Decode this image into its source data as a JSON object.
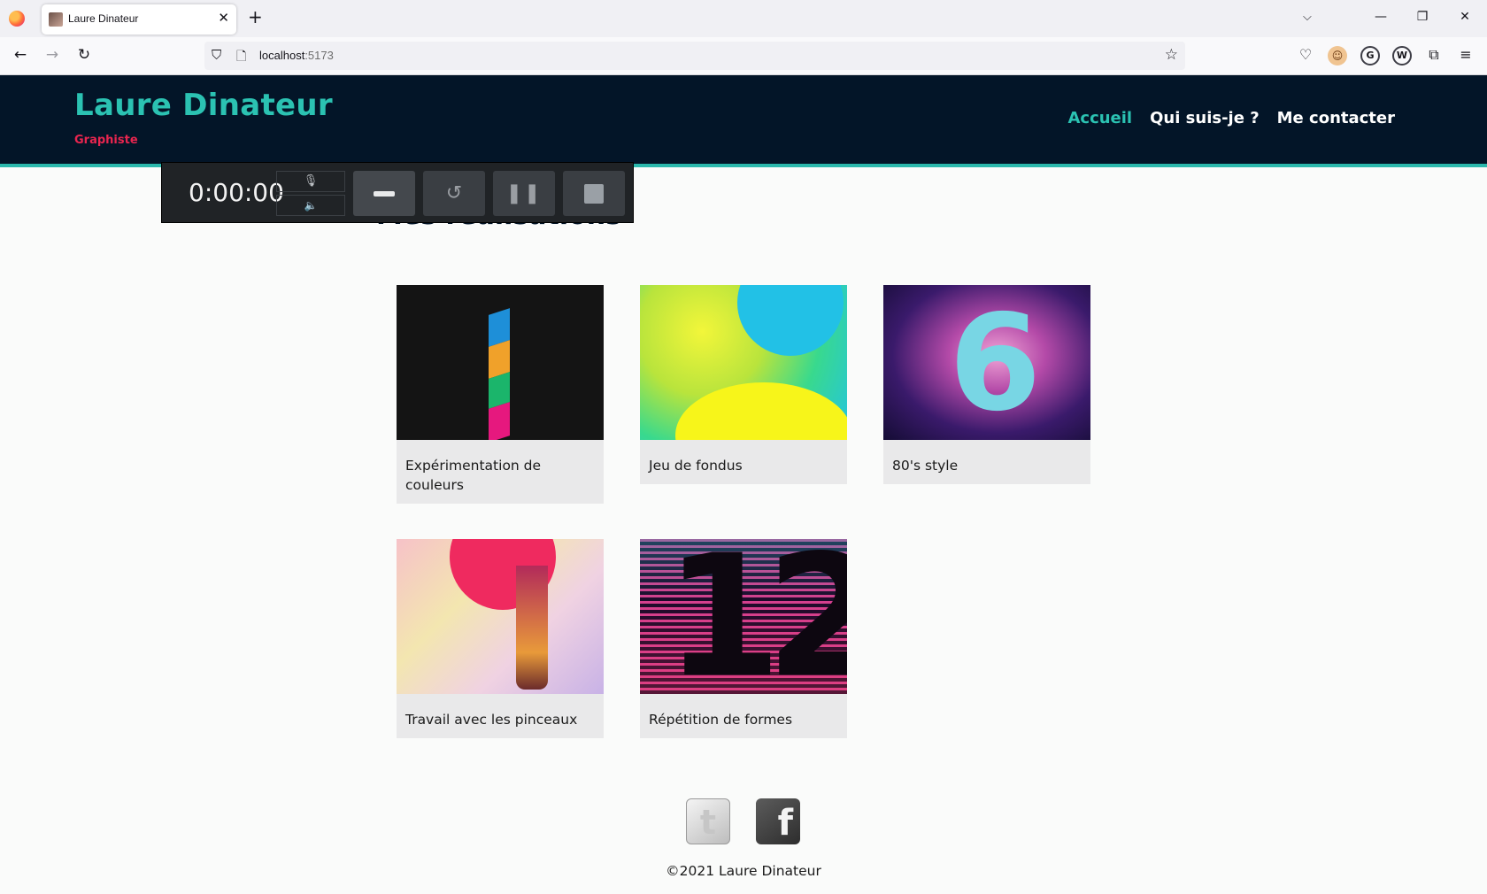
{
  "browser": {
    "tab_title": "Laure Dinateur",
    "url_host": "localhost",
    "url_port": ":5173"
  },
  "site": {
    "brand": "Laure Dinateur",
    "tagline": "Graphiste",
    "menu": [
      {
        "label": "Accueil",
        "active": true
      },
      {
        "label": "Qui suis-je ?",
        "active": false
      },
      {
        "label": "Me contacter",
        "active": false
      }
    ],
    "section_title": "Mes réalisations",
    "cards": [
      {
        "caption": "Expérimentation de couleurs"
      },
      {
        "caption": "Jeu de fondus"
      },
      {
        "caption": "80's style"
      },
      {
        "caption": "Travail avec les pinceaux"
      },
      {
        "caption": "Répétition de formes"
      }
    ],
    "copyright": "©2021 Laure Dinateur"
  },
  "recorder": {
    "time": "0:00:00"
  },
  "colors": {
    "header_bg": "#031528",
    "accent": "#2bc2b2",
    "tagline": "#e8254f"
  }
}
